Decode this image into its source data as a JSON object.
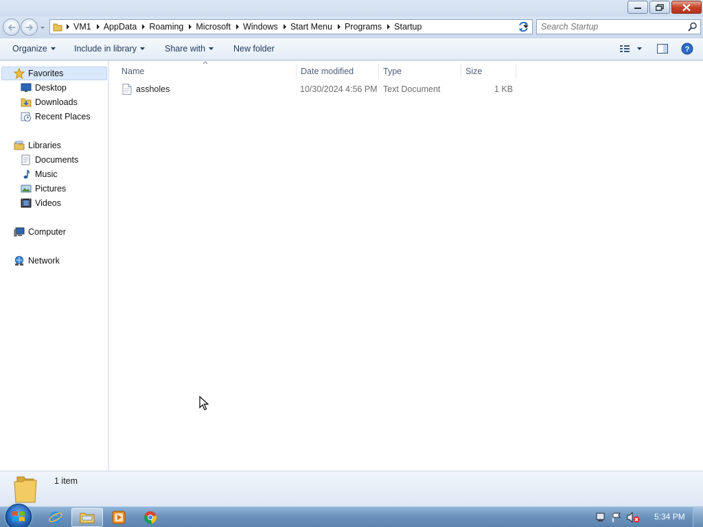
{
  "window": {
    "minimize_icon": "minimize-icon",
    "maximize_icon": "restore-icon",
    "close_icon": "close-icon"
  },
  "address": {
    "breadcrumbs": [
      "VM1",
      "AppData",
      "Roaming",
      "Microsoft",
      "Windows",
      "Start Menu",
      "Programs",
      "Startup"
    ]
  },
  "search": {
    "placeholder": "Search Startup"
  },
  "toolbar": {
    "organize": "Organize",
    "include_in_library": "Include in library",
    "share_with": "Share with",
    "new_folder": "New folder"
  },
  "sidebar": {
    "favorites": {
      "label": "Favorites",
      "items": [
        {
          "label": "Desktop",
          "icon": "desktop-icon"
        },
        {
          "label": "Downloads",
          "icon": "downloads-icon"
        },
        {
          "label": "Recent Places",
          "icon": "recent-places-icon"
        }
      ]
    },
    "libraries": {
      "label": "Libraries",
      "items": [
        {
          "label": "Documents",
          "icon": "documents-icon"
        },
        {
          "label": "Music",
          "icon": "music-icon"
        },
        {
          "label": "Pictures",
          "icon": "pictures-icon"
        },
        {
          "label": "Videos",
          "icon": "videos-icon"
        }
      ]
    },
    "computer": {
      "label": "Computer",
      "icon": "computer-icon"
    },
    "network": {
      "label": "Network",
      "icon": "network-icon"
    }
  },
  "columns": [
    "Name",
    "Date modified",
    "Type",
    "Size"
  ],
  "files": [
    {
      "name": "assholes",
      "date_modified": "10/30/2024 4:56 PM",
      "type": "Text Document",
      "size": "1 KB",
      "icon": "text-file-icon"
    }
  ],
  "status": {
    "item_count": "1 item"
  },
  "taskbar": {
    "apps": [
      "internet-explorer-icon",
      "windows-explorer-icon",
      "media-player-icon",
      "chrome-icon"
    ],
    "clock": "5:34 PM"
  },
  "colors": {
    "accent": "#1f5fb3",
    "selection": "#d9e8fb",
    "close_button": "#c9432b"
  }
}
